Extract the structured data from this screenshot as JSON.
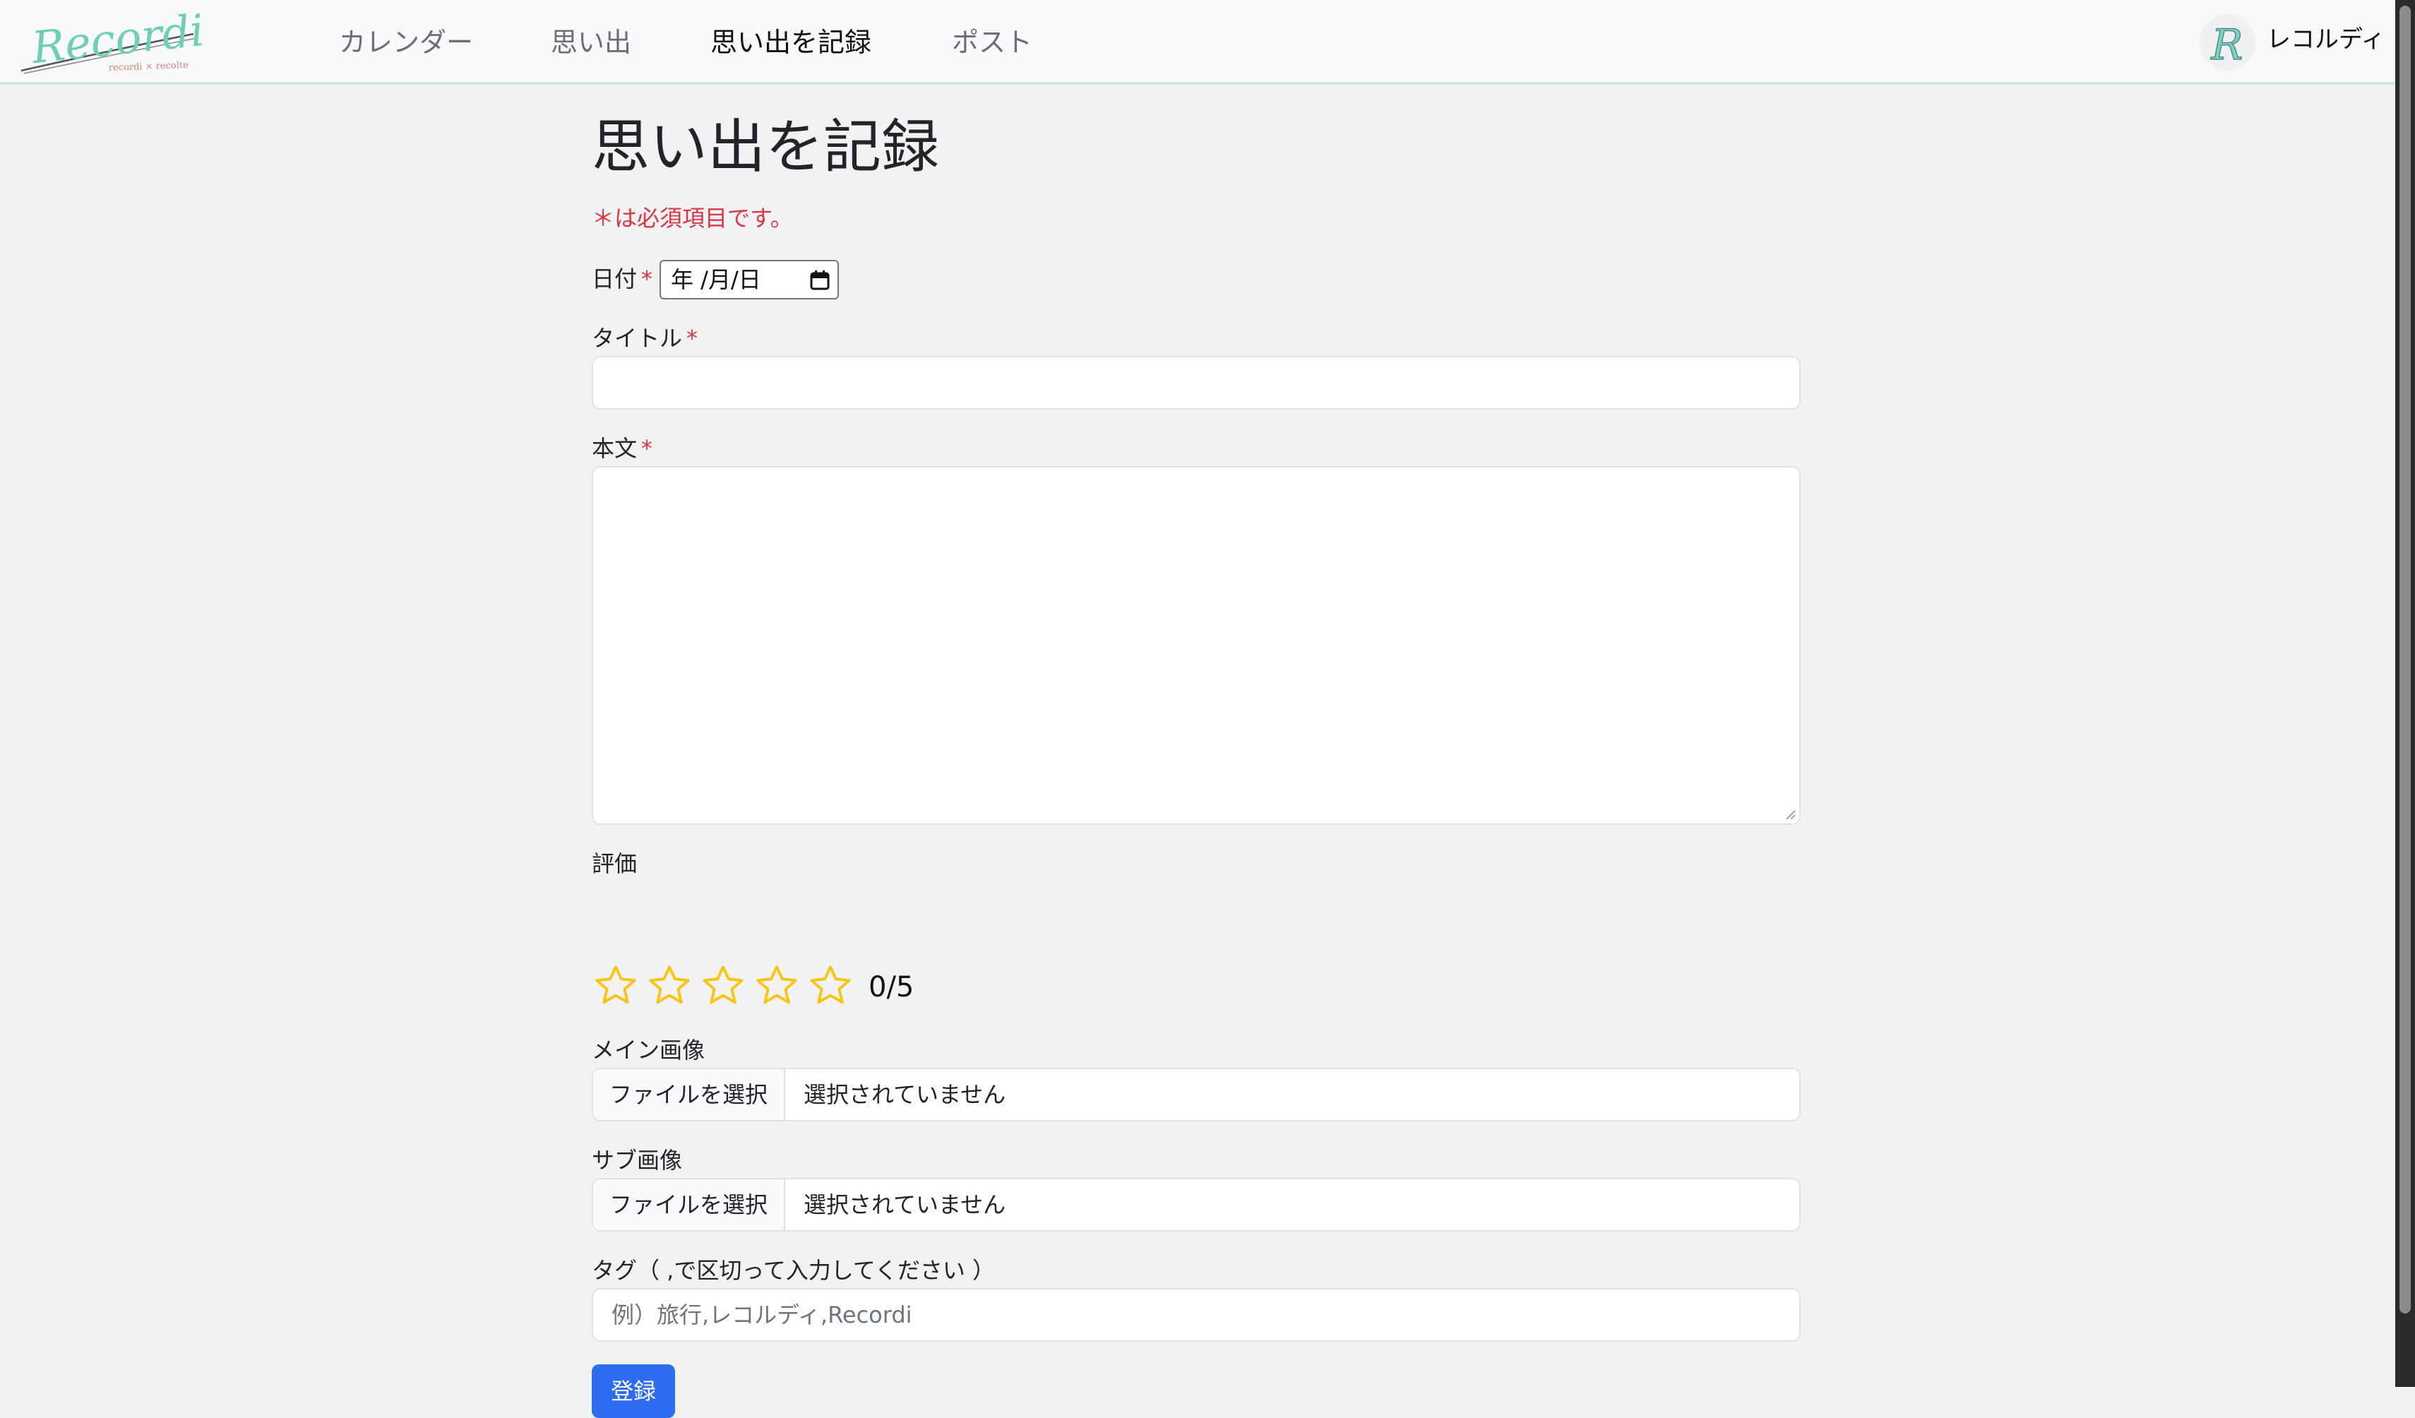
{
  "app": {
    "logo_text": "Recordi",
    "logo_subtext": "recordi × recolte",
    "brand_color": "#6fcfb5"
  },
  "nav": {
    "items": [
      {
        "label": "カレンダー",
        "active": false
      },
      {
        "label": "思い出",
        "active": false
      },
      {
        "label": "思い出を記録",
        "active": true
      },
      {
        "label": "ポスト",
        "active": false
      }
    ]
  },
  "user": {
    "avatar_letter": "R",
    "name": "レコルディ"
  },
  "form": {
    "title": "思い出を記録",
    "required_note": "＊は必須項目です。",
    "required_mark": "*",
    "date": {
      "label": "日付",
      "value": "年 /月/日",
      "icon": "calendar-icon"
    },
    "title_field": {
      "label": "タイトル",
      "value": ""
    },
    "body_field": {
      "label": "本文",
      "value": ""
    },
    "rating": {
      "label": "評価",
      "value": 0,
      "max": 5,
      "display": "0/5",
      "star_color": "#f5c518"
    },
    "main_image": {
      "label": "メイン画像",
      "button": "ファイルを選択",
      "status": "選択されていません"
    },
    "sub_image": {
      "label": "サブ画像",
      "button": "ファイルを選択",
      "status": "選択されていません"
    },
    "tags": {
      "label": "タグ（ ,で区切って入力してください ）",
      "placeholder": "例）旅行,レコルディ,Recordi"
    },
    "submit_label": "登録",
    "submit_color": "#2f6df0"
  }
}
